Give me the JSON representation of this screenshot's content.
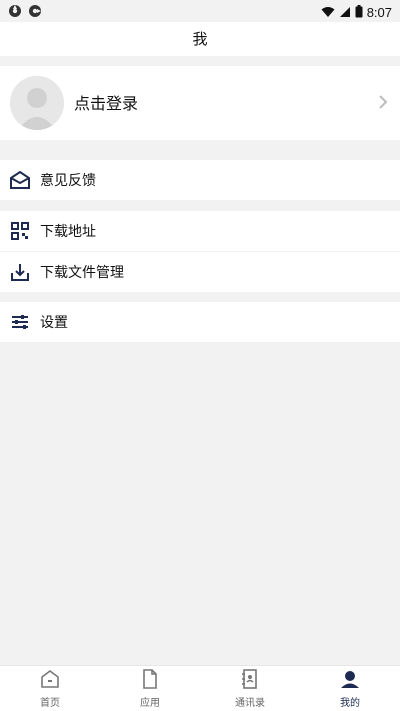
{
  "status": {
    "time": "8:07",
    "left_icons": [
      "aperture-icon",
      "aperture-icon"
    ],
    "right_icons": [
      "wifi-icon",
      "signal-icon",
      "battery-icon"
    ]
  },
  "header": {
    "title": "我"
  },
  "profile": {
    "login_label": "点击登录",
    "avatar": "avatar-placeholder"
  },
  "sections": [
    {
      "items": [
        {
          "icon": "envelope-open-icon",
          "label": "意见反馈"
        }
      ]
    },
    {
      "items": [
        {
          "icon": "qr-code-icon",
          "label": "下载地址"
        },
        {
          "icon": "download-icon",
          "label": "下载文件管理"
        }
      ]
    },
    {
      "items": [
        {
          "icon": "settings-sliders-icon",
          "label": "设置"
        }
      ]
    }
  ],
  "bottom_nav": {
    "items": [
      {
        "label": "首页",
        "icon": "home-icon",
        "active": false
      },
      {
        "label": "应用",
        "icon": "document-icon",
        "active": false
      },
      {
        "label": "通讯录",
        "icon": "contacts-icon",
        "active": false
      },
      {
        "label": "我的",
        "icon": "user-icon",
        "active": true
      }
    ]
  },
  "colors": {
    "primary_dark": "#1f2a52",
    "bg": "#f2f2f2",
    "card": "#ffffff"
  }
}
